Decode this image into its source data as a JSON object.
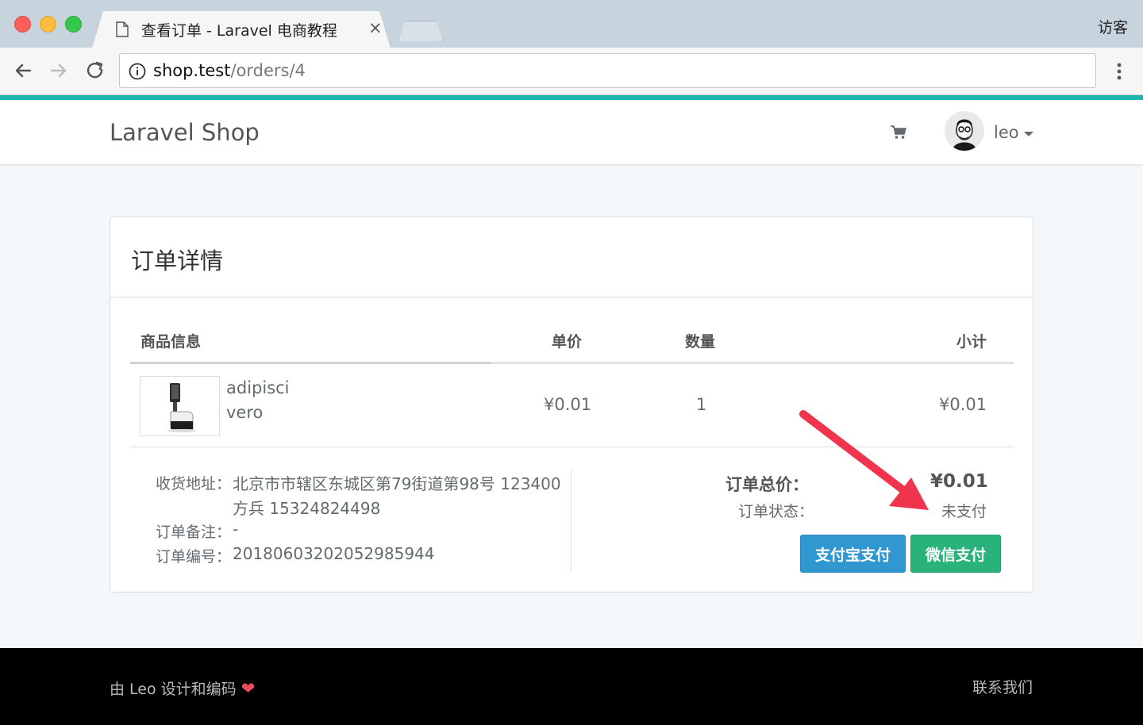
{
  "browser": {
    "tab_title": "查看订单 - Laravel 电商教程",
    "tab_close": "×",
    "profile_label": "访客",
    "url_host": "shop.test",
    "url_path": "/orders/4"
  },
  "navbar": {
    "brand": "Laravel Shop",
    "user_name": "leo",
    "icons": [
      "cart-icon",
      "avatar",
      "caret-down-icon"
    ]
  },
  "order": {
    "panel_title": "订单详情",
    "table": {
      "headers": [
        "商品信息",
        "单价",
        "数量",
        "小计"
      ],
      "rows": [
        {
          "title": "adipisci",
          "sku": "vero",
          "price": "¥0.01",
          "qty": "1",
          "subtotal": "¥0.01"
        }
      ]
    },
    "address_label": "收货地址：",
    "address_line1": "北京市市辖区东城区第79街道第98号 123400",
    "address_line2": "方兵 15324824498",
    "remark_label": "订单备注：",
    "remark_value": "-",
    "no_label": "订单编号：",
    "no_value": "20180603202052985944",
    "total_label": "订单总价：",
    "total_value": "¥0.01",
    "status_label": "订单状态：",
    "status_value": "未支付",
    "alipay_button": "支付宝支付",
    "wechat_button": "微信支付"
  },
  "footer": {
    "left_text": "由 Leo 设计和编码",
    "heart": "❤",
    "right_text": "联系我们"
  },
  "colors": {
    "teal_bar": "#1fb5ad",
    "alipay": "#3097d1",
    "wechat": "#2ab27b",
    "annotation_arrow": "#f0344e"
  }
}
